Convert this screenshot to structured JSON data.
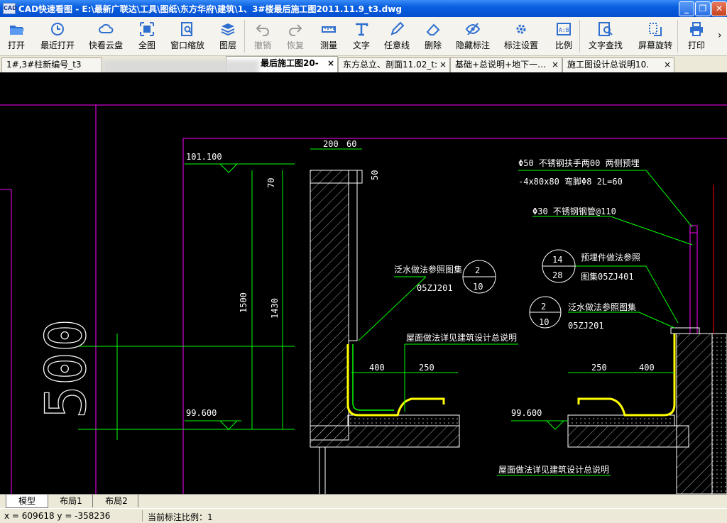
{
  "window": {
    "app_icon": "CAD",
    "title": "CAD快速看图 - E:\\最新广联达\\工具\\图纸\\东方华府\\建筑\\1、3#楼最后施工图2011.11.9_t3.dwg",
    "controls": [
      "minimize",
      "restore",
      "close"
    ]
  },
  "toolbar": {
    "items": [
      {
        "label": "打开",
        "icon": "folder-open-icon"
      },
      {
        "label": "最近打开",
        "icon": "recent-clock-icon"
      },
      {
        "label": "快看云盘",
        "icon": "cloud-icon"
      },
      {
        "label": "全图",
        "icon": "fit-all-icon"
      },
      {
        "label": "窗口缩放",
        "icon": "zoom-window-icon"
      },
      {
        "label": "图层",
        "icon": "layers-icon"
      },
      {
        "label": "撤销",
        "icon": "undo-icon",
        "disabled": true
      },
      {
        "label": "恢复",
        "icon": "redo-icon",
        "disabled": true
      },
      {
        "label": "测量",
        "icon": "measure-icon"
      },
      {
        "label": "文字",
        "icon": "text-icon"
      },
      {
        "label": "任意线",
        "icon": "pencil-icon"
      },
      {
        "label": "删除",
        "icon": "eraser-icon"
      },
      {
        "label": "隐藏标注",
        "icon": "hide-eye-icon"
      },
      {
        "label": "标注设置",
        "icon": "gear-icon"
      },
      {
        "label": "比例",
        "icon": "scale-icon"
      },
      {
        "label": "文字查找",
        "icon": "text-search-icon"
      },
      {
        "label": "屏幕旋转",
        "icon": "rotate-screen-icon"
      },
      {
        "label": "打印",
        "icon": "printer-icon"
      }
    ],
    "overflow": "›"
  },
  "tabs": [
    {
      "label": "1#,3#柱新编号_t3",
      "active": false
    },
    {
      "label": "最后施工图20-",
      "active": true
    },
    {
      "label": "东方总立、剖面11.02_t:",
      "active": false
    },
    {
      "label": "基础+总说明+地下一…",
      "active": false
    },
    {
      "label": "施工图设计总说明10.",
      "active": false
    }
  ],
  "tab_close": "×",
  "drawing": {
    "elev_top": "101.100",
    "elev_bottom_left": "99.600",
    "elev_bottom_right": "99.600",
    "dim_200": "200",
    "dim_60": "60",
    "dim_50": "50",
    "dim_70": "70",
    "dim_1500": "1500",
    "dim_1430": "1430",
    "dim_400_left": "400",
    "dim_250_left": "250",
    "dim_250_right": "250",
    "dim_400_right": "400",
    "big_label": "500",
    "note_handrail_1": "Φ50 不锈钢扶手两00  两侧预埋",
    "note_handrail_2": "-4x80x80    弯脚Φ8  2L=60",
    "note_pipe": "Φ30 不锈钢钢管@110",
    "note_flash_left": "泛水做法参照图集",
    "code_left": "05ZJ201",
    "circle_left_top": "2",
    "circle_left_bottom": "10",
    "note_embed": "预埋件做法参照",
    "note_embed_2": "图集05ZJ401",
    "circle_embed_top": "14",
    "circle_embed_bottom": "28",
    "note_flash_right": "泛水做法参照图集",
    "code_right": "05ZJ201",
    "circle_right_top": "2",
    "circle_right_bottom": "10",
    "note_roof_top": "屋面做法详见建筑设计总说明",
    "note_roof_bottom": "屋面做法详见建筑设计总说明"
  },
  "layout_tabs": [
    "模型",
    "布局1",
    "布局2"
  ],
  "status": {
    "coords": "x = 609618 y = -358236",
    "scale": "当前标注比例：1"
  },
  "colors": {
    "titlebar": "#0a5fe0",
    "canvas_bg": "#000000",
    "line_green": "#00ff00",
    "line_magenta": "#ff00ff",
    "line_yellow": "#ffff00",
    "text_white": "#ffffff"
  }
}
